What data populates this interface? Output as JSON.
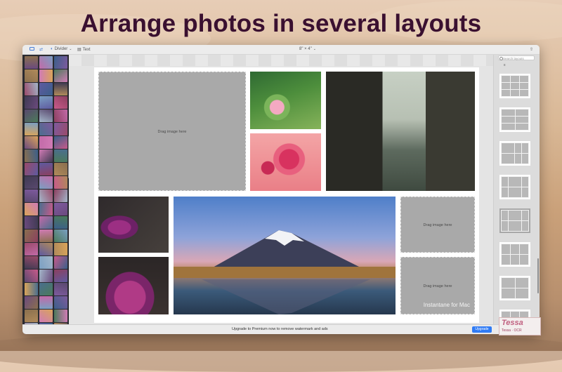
{
  "headline": "Arrange photos in several layouts",
  "toolbar": {
    "divider_label": "Divider",
    "text_label": "Text",
    "page_size": "8\" × 4\""
  },
  "canvas": {
    "drag_text": "Drag image here",
    "watermark": "Instantane for Mac"
  },
  "layouts_panel": {
    "search_placeholder": "Search layouts",
    "count": "8"
  },
  "bottom_bar": {
    "upgrade_message": "Upgrade to Premium now to remove watermark and ads",
    "upgrade_button": "Upgrade"
  },
  "badge": {
    "logo": "Tessa",
    "text": "Tessa · OCR"
  },
  "colors": {
    "headline": "#3a1030",
    "accent": "#2f7bf5",
    "placeholder": "#a9a9a9"
  }
}
